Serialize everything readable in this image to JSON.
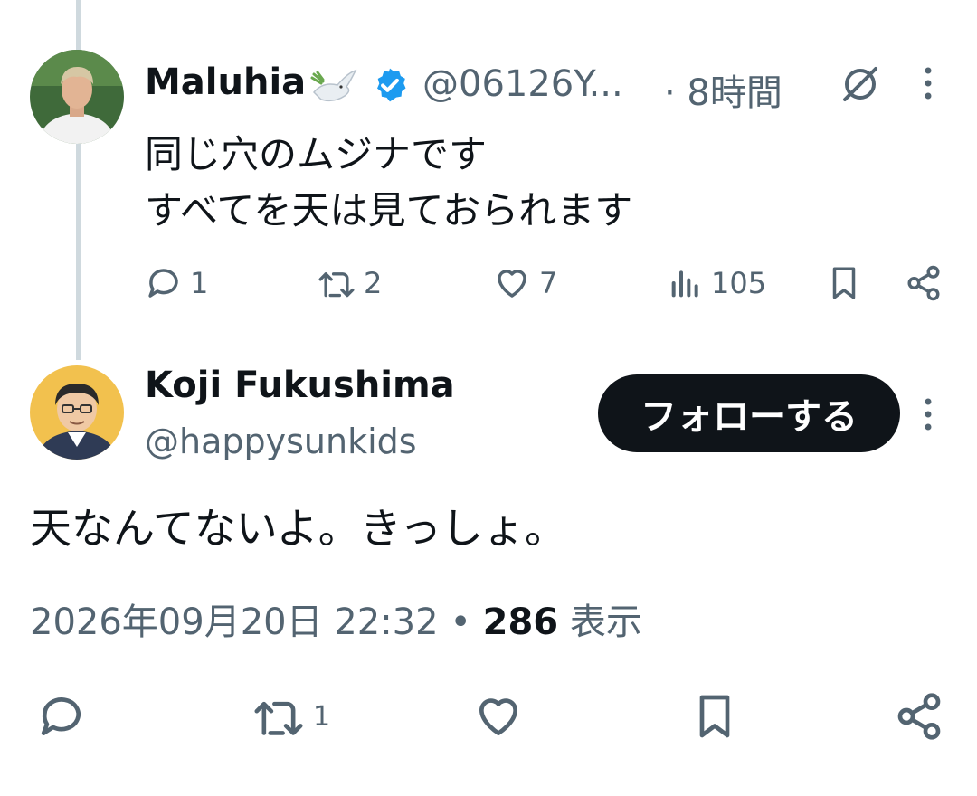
{
  "reply_tweet": {
    "display_name": "Maluhia",
    "handle": "@06126Y...",
    "time": "· 8時間",
    "lines": [
      "同じ穴のムジナです",
      "すべてを天は見ておられます"
    ],
    "actions": {
      "reply_count": "1",
      "retweet_count": "2",
      "like_count": "7",
      "view_count": "105"
    }
  },
  "main_tweet": {
    "display_name": "Koji Fukushima",
    "handle": "@happysunkids",
    "follow_label": "フォローする",
    "text": "天なんてないよ。きっしょ。",
    "datetime": "2026年09月20日 22:32",
    "separator": "•",
    "views_count": "286",
    "views_label": "表示",
    "actions": {
      "retweet_count": "1"
    }
  },
  "colors": {
    "text": "#0f1419",
    "muted": "#536471",
    "verified": "#1d9bf0",
    "thread_line": "#cfd9de",
    "follow_bg": "#0f1419"
  }
}
